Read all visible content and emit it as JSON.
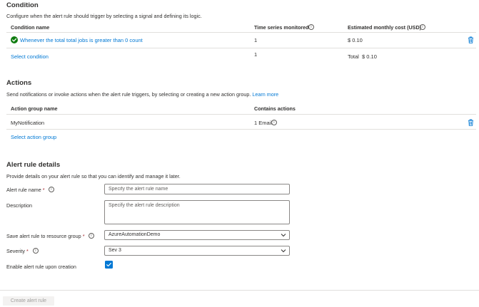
{
  "condition": {
    "heading": "Condition",
    "description": "Configure when the alert rule should trigger by selecting a signal and defining its logic.",
    "columns": {
      "name": "Condition name",
      "time_series": "Time series monitored",
      "cost": "Estimated monthly cost (USD)"
    },
    "row": {
      "name": "Whenever the total total jobs is greater than 0 count",
      "time_series": "1",
      "cost": "$ 0.10"
    },
    "select_link": "Select condition",
    "summary": {
      "time_series": "1",
      "total_label": "Total",
      "total_value": "$ 0.10"
    }
  },
  "actions": {
    "heading": "Actions",
    "description": "Send notifications or invoke actions when the alert rule triggers, by selecting or creating a new action group.",
    "learn_more": "Learn more",
    "columns": {
      "name": "Action group name",
      "contains": "Contains actions"
    },
    "row": {
      "name": "MyNotification",
      "contains": "1 Email"
    },
    "select_link": "Select action group"
  },
  "details": {
    "heading": "Alert rule details",
    "description": "Provide details on your alert rule so that you can identify and manage it later.",
    "name_label": "Alert rule name",
    "name_placeholder": "Specify the alert rule name",
    "description_label": "Description",
    "description_placeholder": "Specify the alert rule description",
    "resource_group_label": "Save alert rule to resource group",
    "resource_group_value": "AzureAutomationDemo",
    "severity_label": "Severity",
    "severity_value": "Sev 3",
    "enable_label": "Enable alert rule upon creation",
    "enable_checked": true,
    "required_marker": "*"
  },
  "footer": {
    "create_button": "Create alert rule"
  },
  "colors": {
    "accent": "#0078d4",
    "success": "#107c10",
    "required": "#a4262c"
  },
  "icons": {
    "info": "info-icon",
    "delete": "trash-icon",
    "status": "check-circle-icon",
    "dropdown": "chevron-down-icon"
  }
}
